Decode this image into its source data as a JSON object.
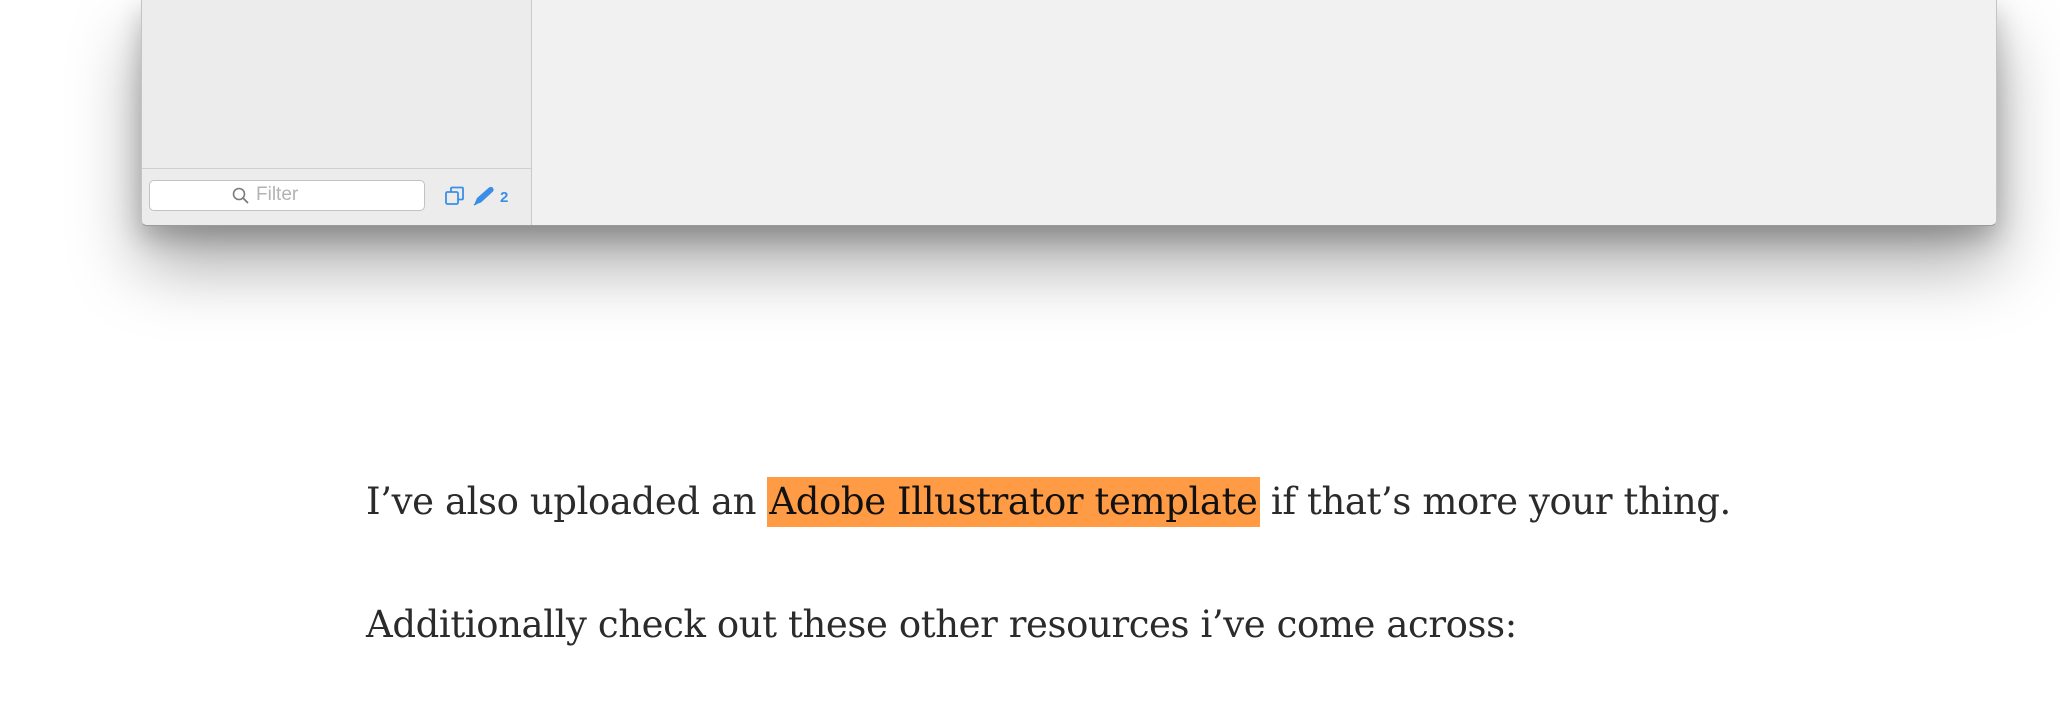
{
  "app_window": {
    "sidebar": {
      "filter": {
        "placeholder": "Filter",
        "value": ""
      },
      "footer_icons": [
        {
          "name": "duplicate-icon"
        },
        {
          "name": "pen-icon"
        }
      ],
      "pen_count": "2"
    }
  },
  "article": {
    "paragraph1": {
      "before": "I’ve also uploaded an ",
      "link_text": "Adobe Illustrator template",
      "after": " if that’s more your thing."
    },
    "paragraph2": "Additionally check out these other resources i’ve come across:"
  },
  "colors": {
    "highlight": "#ff9b45",
    "accent_blue": "#3a8ee6",
    "text": "#2b2b2b"
  }
}
